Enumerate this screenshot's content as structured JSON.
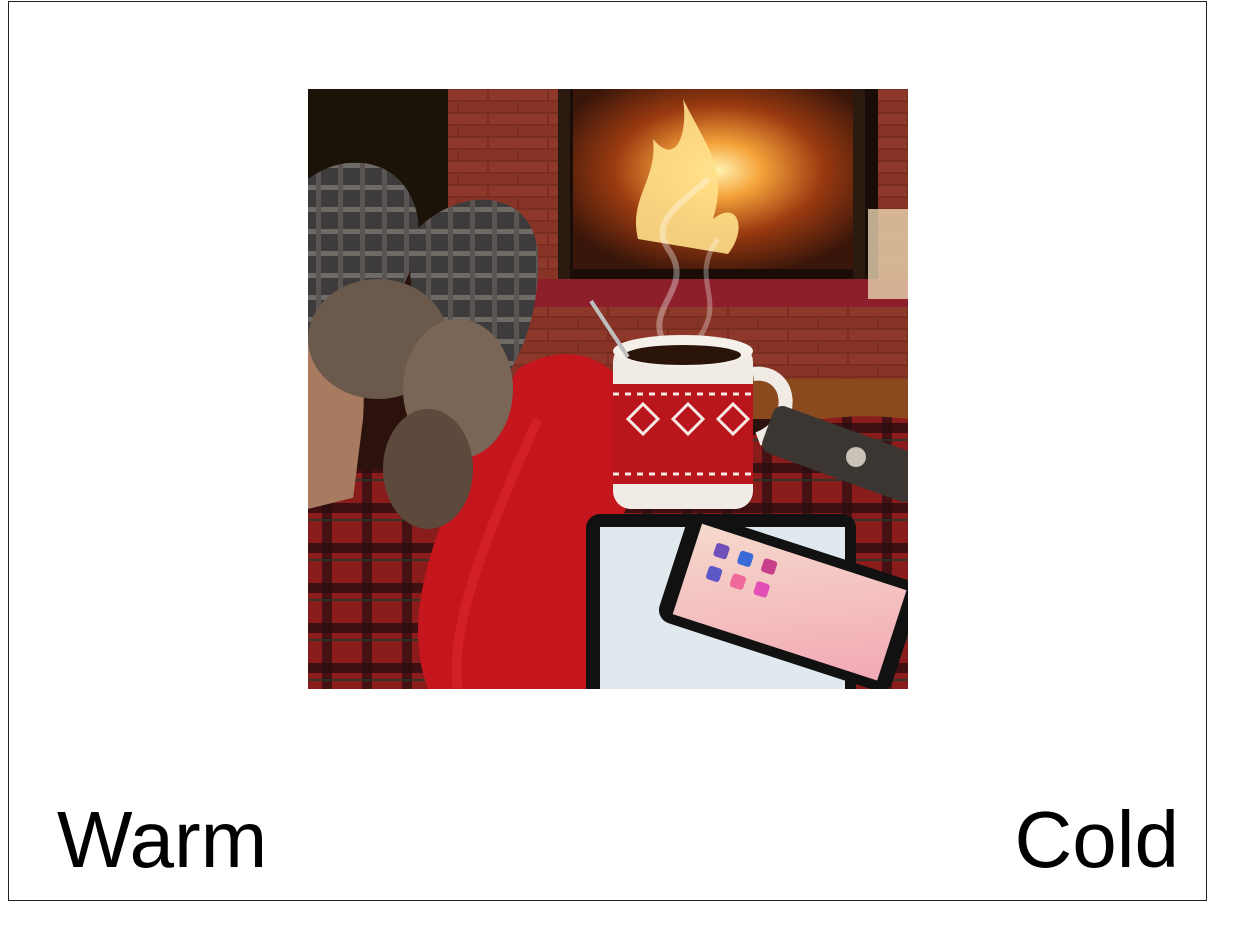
{
  "card": {
    "image_subject": "cozy-fireplace-scene",
    "options": {
      "left_label": "Warm",
      "right_label": "Cold"
    }
  }
}
